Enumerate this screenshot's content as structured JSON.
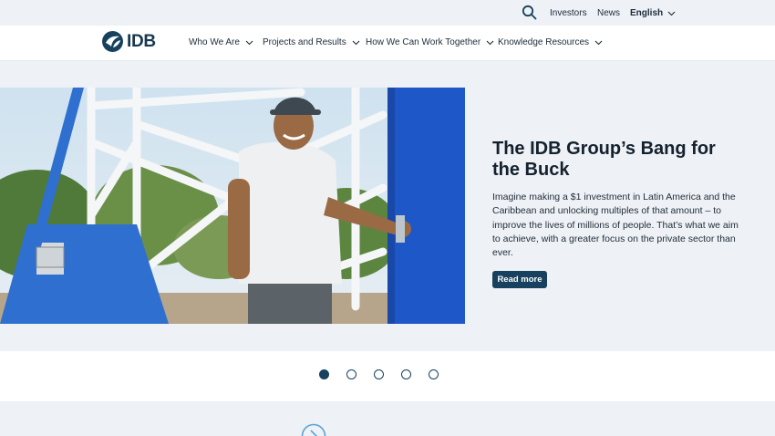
{
  "utility": {
    "search_icon": "search-icon",
    "investors": "Investors",
    "news": "News",
    "language": "English"
  },
  "nav": {
    "logo_text": "IDB",
    "items": [
      {
        "label": "Who We Are"
      },
      {
        "label": "Projects and Results"
      },
      {
        "label": "How We Can Work Together"
      },
      {
        "label": "Knowledge Resources"
      }
    ]
  },
  "hero": {
    "title": "The IDB Group’s Bang for the Buck",
    "body": "Imagine making a $1 investment in Latin America and the Caribbean and unlocking multiples of that amount – to improve the lives of millions of people. That’s what we aim to achieve, with a greater focus on the private sector than ever.",
    "cta": "Read more"
  },
  "carousel": {
    "slide_count": 5,
    "active_index": 0
  },
  "colors": {
    "brand": "#17415e",
    "background": "#eef1f5"
  }
}
